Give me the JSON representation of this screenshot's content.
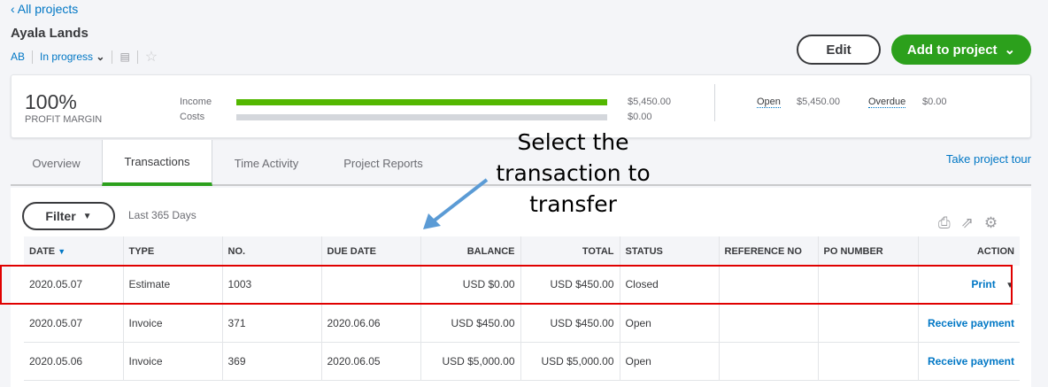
{
  "nav": {
    "back": "All projects"
  },
  "project": {
    "name": "Ayala Lands",
    "initials": "AB",
    "status": "In progress"
  },
  "buttons": {
    "edit": "Edit",
    "add": "Add to project",
    "filter": "Filter"
  },
  "summary": {
    "margin": "100%",
    "margin_label": "PROFIT MARGIN",
    "income_label": "Income",
    "income": "$5,450.00",
    "costs_label": "Costs",
    "costs": "$0.00",
    "income_fraction": 1.0,
    "costs_fraction": 0.0,
    "open_label": "Open",
    "open": "$5,450.00",
    "overdue_label": "Overdue",
    "overdue": "$0.00"
  },
  "tabs": [
    "Overview",
    "Transactions",
    "Time Activity",
    "Project Reports"
  ],
  "tour": "Take project tour",
  "filter_range": "Last 365 Days",
  "annotation": "Select the transaction to transfer",
  "table": {
    "headers": [
      "DATE",
      "TYPE",
      "NO.",
      "DUE DATE",
      "BALANCE",
      "TOTAL",
      "STATUS",
      "REFERENCE NO",
      "PO NUMBER",
      "ACTION"
    ],
    "rows": [
      [
        "2020.05.07",
        "Estimate",
        "1003",
        "",
        "USD $0.00",
        "USD $450.00",
        "Closed",
        "",
        "",
        "Print"
      ],
      [
        "2020.05.07",
        "Invoice",
        "371",
        "2020.06.06",
        "USD $450.00",
        "USD $450.00",
        "Open",
        "",
        "",
        "Receive payment"
      ],
      [
        "2020.05.06",
        "Invoice",
        "369",
        "2020.06.05",
        "USD $5,000.00",
        "USD $5,000.00",
        "Open",
        "",
        "",
        "Receive payment"
      ]
    ]
  },
  "colors": {
    "green": "#2ca01c",
    "blue": "#0077c5",
    "highlight": "#e00000"
  }
}
